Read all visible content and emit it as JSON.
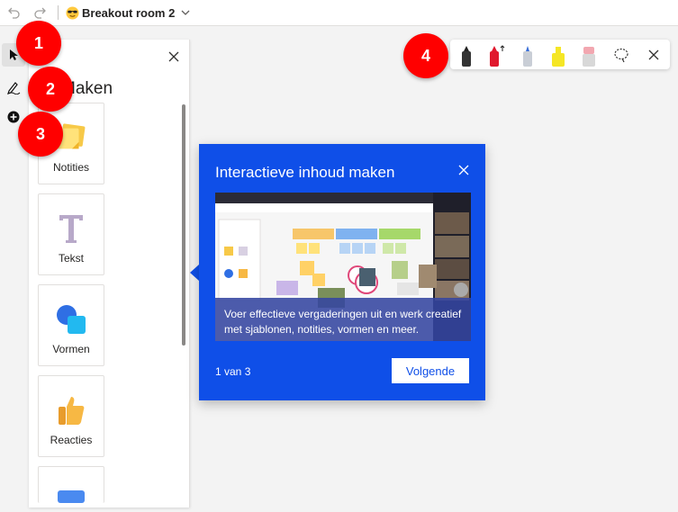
{
  "topbar": {
    "room_title": "Breakout room 2",
    "icons": [
      "undo-icon",
      "redo-icon",
      "sunglasses-emoji-icon",
      "chevron-down-icon"
    ]
  },
  "rail": {
    "tools": [
      "select-arrow-icon",
      "pen-icon",
      "add-icon"
    ]
  },
  "panel": {
    "title": "Maken",
    "items": [
      {
        "label": "Notities",
        "icon": "sticky-notes-icon"
      },
      {
        "label": "Tekst",
        "icon": "text-icon"
      },
      {
        "label": "Vormen",
        "icon": "shapes-icon"
      },
      {
        "label": "Reacties",
        "icon": "thumbs-up-icon"
      },
      {
        "label": "",
        "icon": "image-icon"
      }
    ]
  },
  "callout": {
    "title": "Interactieve inhoud maken",
    "description": "Voer effectieve vergaderingen uit en werk creatief met sjablonen, notities, vormen en meer.",
    "pager": "1 van 3",
    "next_label": "Volgende"
  },
  "ink_toolbar": {
    "tools": [
      "black-pen-icon",
      "red-arrow-pen-icon",
      "blue-pen-icon",
      "highlighter-icon",
      "eraser-icon",
      "lasso-icon",
      "close-icon"
    ],
    "colors": {
      "black": "#222222",
      "red": "#e0182d",
      "blue": "#3a6fd8",
      "highlighter": "#f5e625",
      "eraser": "#f2a7b0"
    }
  },
  "markers": [
    "1",
    "2",
    "3",
    "4"
  ],
  "colors": {
    "callout_bg": "#0f4fe8",
    "marker_red": "#ff0000"
  }
}
